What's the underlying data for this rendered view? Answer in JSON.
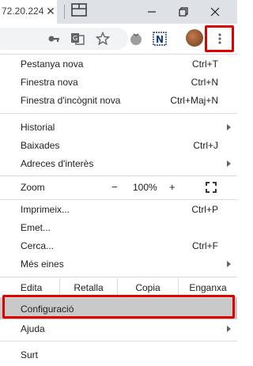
{
  "titlebar": {
    "tab_title": "72.20.224",
    "tab_close_icon": "close-icon",
    "tab_search_icon": "tab-search-icon",
    "minimize_icon": "minimize-icon",
    "restore_icon": "restore-icon",
    "close_window_icon": "close-window-icon"
  },
  "toolbar": {
    "icons": [
      "key-icon",
      "translate-icon",
      "bookmark-star-icon",
      "extension-tomato-icon",
      "extension-n-icon",
      "avatar",
      "more-menu-icon"
    ]
  },
  "menu": {
    "new_tab": {
      "label": "Pestanya nova",
      "shortcut": "Ctrl+T"
    },
    "new_window": {
      "label": "Finestra nova",
      "shortcut": "Ctrl+N"
    },
    "incognito": {
      "label": "Finestra d'incògnit nova",
      "shortcut": "Ctrl+Maj+N"
    },
    "history": {
      "label": "Historial"
    },
    "downloads": {
      "label": "Baixades",
      "shortcut": "Ctrl+J"
    },
    "bookmarks": {
      "label": "Adreces d'interès"
    },
    "zoom": {
      "label": "Zoom",
      "minus": "−",
      "value": "100%",
      "plus": "+"
    },
    "print": {
      "label": "Imprimeix...",
      "shortcut": "Ctrl+P"
    },
    "cast": {
      "label": "Emet..."
    },
    "find": {
      "label": "Cerca...",
      "shortcut": "Ctrl+F"
    },
    "more_tools": {
      "label": "Més eines"
    },
    "edit": {
      "label": "Edita",
      "cut": "Retalla",
      "copy": "Copia",
      "paste": "Enganxa"
    },
    "settings": {
      "label": "Configuració"
    },
    "help": {
      "label": "Ajuda"
    },
    "exit": {
      "label": "Surt"
    }
  },
  "colors": {
    "highlight_border": "#e00000",
    "selected_bg": "#c9c9c9"
  }
}
